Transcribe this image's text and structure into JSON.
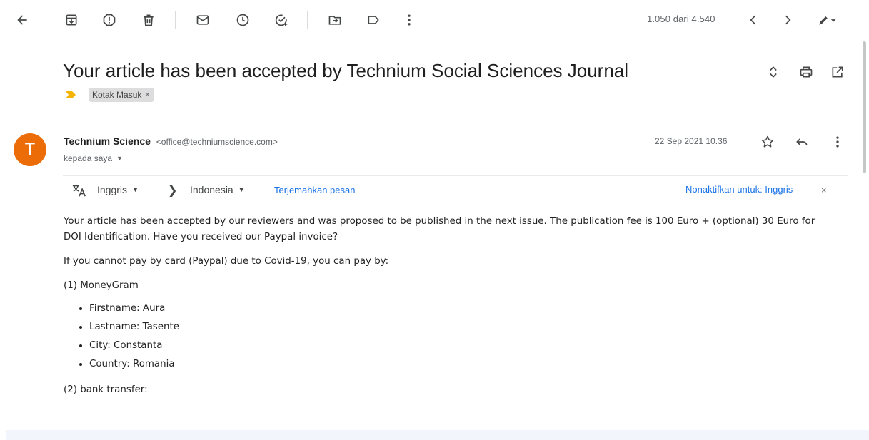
{
  "toolbar": {
    "icons": [
      "back-arrow-icon",
      "archive-icon",
      "report-spam-icon",
      "delete-icon",
      "mark-unread-icon",
      "snooze-icon",
      "add-task-icon",
      "move-to-icon",
      "label-icon",
      "more-vert-icon"
    ],
    "pager_text": "1.050 dari 4.540"
  },
  "email": {
    "subject": "Your article has been accepted by Technium Social Sciences Journal",
    "label_chip": "Kotak Masuk",
    "label_chip_close": "×",
    "sender_initial": "T",
    "sender_name": "Technium Science",
    "sender_email": "<office@techniumscience.com>",
    "to_text": "kepada saya",
    "date": "22 Sep 2021 10.36"
  },
  "translate": {
    "from_lang": "Inggris",
    "to_lang": "Indonesia",
    "translate_link": "Terjemahkan pesan",
    "disable_link": "Nonaktifkan untuk: Inggris",
    "close": "×"
  },
  "body": {
    "para1": "Your article has been accepted by our reviewers and was proposed to be published in the next issue. The publication fee is 100 Euro + (optional) 30 Euro for DOI Identification. Have you received our Paypal invoice?",
    "para2": "If you cannot pay by card (Paypal) due to Covid-19, you can pay by:",
    "option1_title": "(1) MoneyGram",
    "option1_items": [
      "Firstname: Aura",
      "Lastname: Tasente",
      "City: Constanta",
      "Country: Romania"
    ],
    "option2_title": "(2) bank transfer:"
  },
  "colors": {
    "avatar": "#ec6c07",
    "link": "#1a73e8",
    "importance_marker": "#f4b400",
    "chip_bg": "#dddddd"
  }
}
